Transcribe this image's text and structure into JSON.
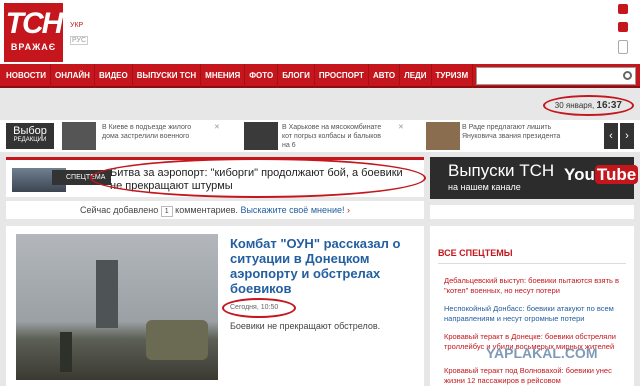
{
  "logo": {
    "mark": "ТСН",
    "sub": "ВРАЖАЄ"
  },
  "lang": {
    "ukr": "УКР",
    "rus": "РУС"
  },
  "nav": [
    "НОВОСТИ",
    "ОНЛАЙН",
    "ВИДЕО",
    "ВЫПУСКИ ТСН",
    "МНЕНИЯ",
    "ФОТО",
    "БЛОГИ",
    "ПРОСПОРТ",
    "АВТО",
    "ЛЕДИ",
    "ТУРИЗМ"
  ],
  "search": {
    "placeholder": ""
  },
  "date": {
    "day": "30 января,",
    "time": "16:37"
  },
  "ticker": {
    "vybor_title": "Выбор",
    "vybor_sub": "РЕДАКЦИИ",
    "items": [
      "В Киеве в подъезде жилого дома застрелили военного",
      "В Харькове на мясокомбинате кот погрыз колбасы и балыков на 6",
      "В Раде предлагают лишить Януковича звания президента"
    ]
  },
  "spec": {
    "tag": "СПЕЦТЕМА",
    "title": "Битва за аэропорт: \"киборги\" продолжают бой, а боевики не прекращают штурмы"
  },
  "added": {
    "pre": "Сейчас добавлено",
    "count": "1",
    "post": "комментариев.",
    "link": "Выскажите своё мнение!",
    "arrow": "›"
  },
  "main": {
    "headline": "Комбат \"ОУН\" рассказал о ситуации в Донецком аэропорту и обстрелах боевиков",
    "time": "Сегодня, 10:50",
    "lead": "Боевики не прекращают обстрелов."
  },
  "promo": {
    "line1": "Выпуски ТСН",
    "line2": "на нашем канале",
    "yt_you": "You",
    "yt_tube": "Tube"
  },
  "side": {
    "head": "ВСЕ СПЕЦТЕМЫ",
    "items": [
      {
        "text": "Дебальцевский выступ: боевики пытаются взять в \"котел\" военных, но несут потери",
        "color": "red"
      },
      {
        "text": "Неспокойный Донбасс: боевики атакуют по всем направлениям и несут огромные потери",
        "color": "blue"
      },
      {
        "text": "Кровавый теракт в Донецке: боевики обстреляли троллейбус и убили восьмерых мирных жителей",
        "color": "red"
      },
      {
        "text": "Кровавый теракт под Волновахой: боевики унес жизни 12 пассажиров в рейсовом",
        "color": "red"
      }
    ]
  },
  "watermark": "YAPLAKAL.COM"
}
